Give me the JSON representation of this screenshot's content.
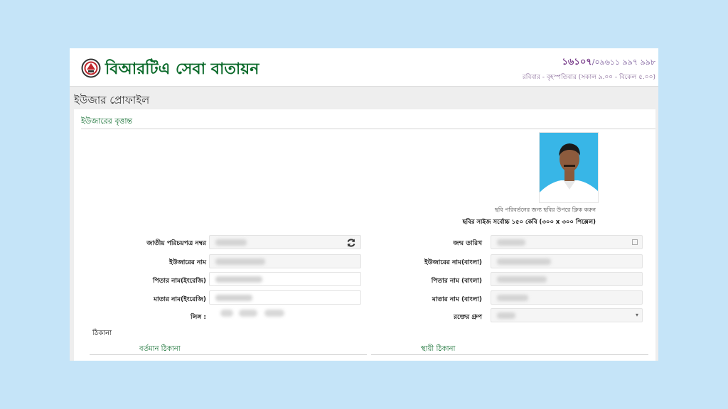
{
  "header": {
    "brand": "বিআরটিএ সেবা বাতায়ন",
    "hotline": "১৬১০৭",
    "phone_alt": "/০৯৬১১ ৯৯৭ ৯৯৮",
    "hours": "রবিবার - বৃহস্পতিবার (সকাল ৯.০০ - বিকেল ৫.০০)"
  },
  "page": {
    "title": "ইউজার প্রোফাইল"
  },
  "profile": {
    "section_title": "ইউজারের বৃত্তান্ত",
    "photo_note": "ছবি পরিবর্তনের জন্য ছবির উপরে ক্লিক করুন",
    "size_note": "ছবির সাইজ সর্বোচ্চ ১৫০ কেবি (৩০০ x ৩০০ পিক্সেল)",
    "fields": {
      "nid": "জাতীয় পরিচয়পত্র নম্বর",
      "dob": "জন্ম তারিখ",
      "name_en": "ইউজারের নাম",
      "name_bn": "ইউজারের নাম(বাংলা)",
      "father_en": "পিতার নাম(ইংরেজি)",
      "father_bn": "পিতার নাম (বাংলা)",
      "mother_en": "মাতার নাম(ইংরেজি)",
      "mother_bn": "মাতার নাম (বাংলা)",
      "gender": "লিঙ্গ :",
      "blood": "রক্তের গ্রুপ"
    },
    "address": {
      "label": "ঠিকানা",
      "present": "বর্তমান ঠিকানা",
      "permanent": "স্থায়ী ঠিকানা"
    }
  },
  "icons": {
    "refresh": "refresh-icon",
    "calendar": "calendar-icon",
    "logo": "brta-logo"
  },
  "colors": {
    "brand": "#0d6b2c",
    "background": "#c5e4f8",
    "hotline": "#7a3f8c"
  }
}
